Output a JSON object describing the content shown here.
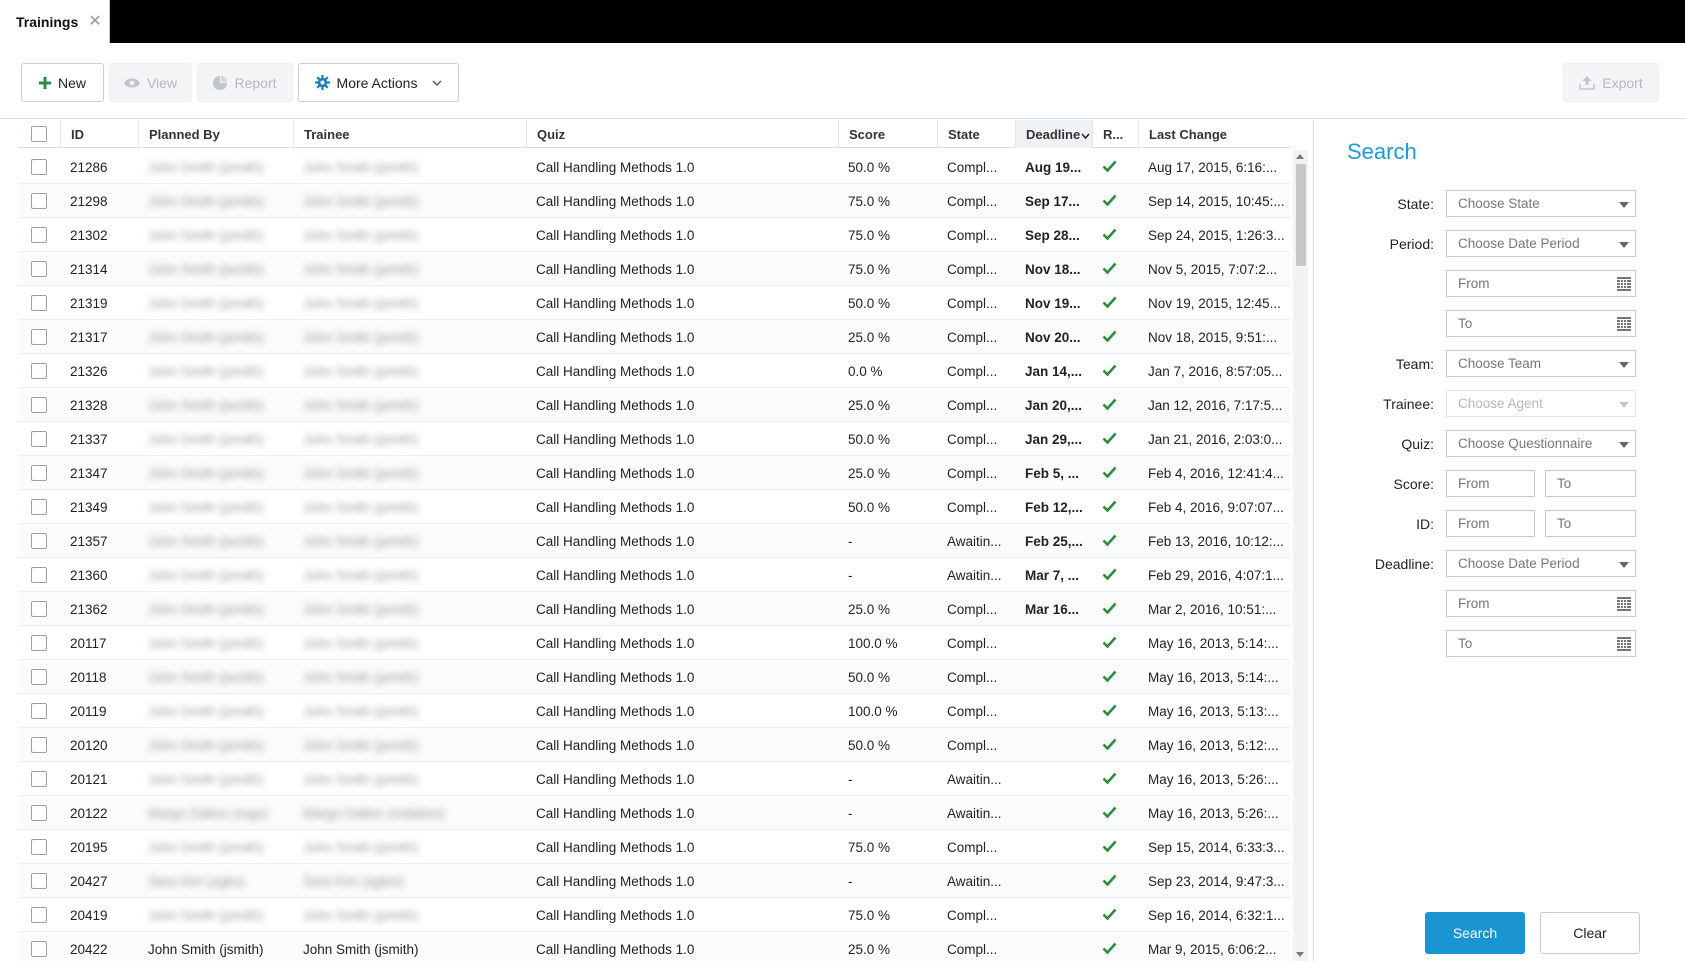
{
  "tab": {
    "label": "Trainings",
    "close": "✕"
  },
  "toolbar": {
    "new_label": "New",
    "view_label": "View",
    "report_label": "Report",
    "more_label": "More Actions",
    "export_label": "Export"
  },
  "colors": {
    "accent": "#1a95d1",
    "check": "#2e8b3d",
    "new_plus": "#2e8b3d"
  },
  "columns": {
    "id": "ID",
    "planned_by": "Planned By",
    "trainee": "Trainee",
    "quiz": "Quiz",
    "score": "Score",
    "state": "State",
    "deadline": "Deadline",
    "r": "R...",
    "last_change": "Last Change"
  },
  "rows": [
    {
      "id": "21286",
      "planned_by": "John Smith (jsmith)",
      "trainee": "John Smith (jsmith)",
      "quiz": "Call Handling Methods 1.0",
      "score": "50.0 %",
      "state": "Compl...",
      "deadline": "Aug 19...",
      "last_change": "Aug 17, 2015, 6:16:..."
    },
    {
      "id": "21298",
      "planned_by": "John Smith (jsmith)",
      "trainee": "John Smith (jsmith)",
      "quiz": "Call Handling Methods 1.0",
      "score": "75.0 %",
      "state": "Compl...",
      "deadline": "Sep 17...",
      "last_change": "Sep 14, 2015, 10:45:..."
    },
    {
      "id": "21302",
      "planned_by": "John Smith (jsmith)",
      "trainee": "John Smith (jsmith)",
      "quiz": "Call Handling Methods 1.0",
      "score": "75.0 %",
      "state": "Compl...",
      "deadline": "Sep 28...",
      "last_change": "Sep 24, 2015, 1:26:3..."
    },
    {
      "id": "21314",
      "planned_by": "John Smith (jsmith)",
      "trainee": "John Smith (jsmith)",
      "quiz": "Call Handling Methods 1.0",
      "score": "75.0 %",
      "state": "Compl...",
      "deadline": "Nov 18...",
      "last_change": "Nov 5, 2015, 7:07:2..."
    },
    {
      "id": "21319",
      "planned_by": "John Smith (jsmith)",
      "trainee": "John Smith (jsmith)",
      "quiz": "Call Handling Methods 1.0",
      "score": "50.0 %",
      "state": "Compl...",
      "deadline": "Nov 19...",
      "last_change": "Nov 19, 2015, 12:45..."
    },
    {
      "id": "21317",
      "planned_by": "John Smith (jsmith)",
      "trainee": "John Smith (jsmith)",
      "quiz": "Call Handling Methods 1.0",
      "score": "25.0 %",
      "state": "Compl...",
      "deadline": "Nov 20...",
      "last_change": "Nov 18, 2015, 9:51:..."
    },
    {
      "id": "21326",
      "planned_by": "John Smith (jsmith)",
      "trainee": "John Smith (jsmith)",
      "quiz": "Call Handling Methods 1.0",
      "score": "0.0 %",
      "state": "Compl...",
      "deadline": "Jan 14,...",
      "last_change": "Jan 7, 2016, 8:57:05..."
    },
    {
      "id": "21328",
      "planned_by": "John Smith (jsmith)",
      "trainee": "John Smith (jsmith)",
      "quiz": "Call Handling Methods 1.0",
      "score": "25.0 %",
      "state": "Compl...",
      "deadline": "Jan 20,...",
      "last_change": "Jan 12, 2016, 7:17:5..."
    },
    {
      "id": "21337",
      "planned_by": "John Smith (jsmith)",
      "trainee": "John Smith (jsmith)",
      "quiz": "Call Handling Methods 1.0",
      "score": "50.0 %",
      "state": "Compl...",
      "deadline": "Jan 29,...",
      "last_change": "Jan 21, 2016, 2:03:0..."
    },
    {
      "id": "21347",
      "planned_by": "John Smith (jsmith)",
      "trainee": "John Smith (jsmith)",
      "quiz": "Call Handling Methods 1.0",
      "score": "25.0 %",
      "state": "Compl...",
      "deadline": "Feb 5, ...",
      "last_change": "Feb 4, 2016, 12:41:4..."
    },
    {
      "id": "21349",
      "planned_by": "John Smith (jsmith)",
      "trainee": "John Smith (jsmith)",
      "quiz": "Call Handling Methods 1.0",
      "score": "50.0 %",
      "state": "Compl...",
      "deadline": "Feb 12,...",
      "last_change": "Feb 4, 2016, 9:07:07..."
    },
    {
      "id": "21357",
      "planned_by": "John Smith (jsmith)",
      "trainee": "John Smith (jsmith)",
      "quiz": "Call Handling Methods 1.0",
      "score": "-",
      "state": "Awaitin...",
      "deadline": "Feb 25,...",
      "last_change": "Feb 13, 2016, 10:12:..."
    },
    {
      "id": "21360",
      "planned_by": "John Smith (jsmith)",
      "trainee": "John Smith (jsmith)",
      "quiz": "Call Handling Methods 1.0",
      "score": "-",
      "state": "Awaitin...",
      "deadline": "Mar 7, ...",
      "last_change": "Feb 29, 2016, 4:07:1..."
    },
    {
      "id": "21362",
      "planned_by": "John Smith (jsmith)",
      "trainee": "John Smith (jsmith)",
      "quiz": "Call Handling Methods 1.0",
      "score": "25.0 %",
      "state": "Compl...",
      "deadline": "Mar 16...",
      "last_change": "Mar 2, 2016, 10:51:..."
    },
    {
      "id": "20117",
      "planned_by": "John Smith (jsmith)",
      "trainee": "John Smith (jsmith)",
      "quiz": "Call Handling Methods 1.0",
      "score": "100.0 %",
      "state": "Compl...",
      "deadline": "",
      "last_change": "May 16, 2013, 5:14:..."
    },
    {
      "id": "20118",
      "planned_by": "John Smith (jsmith)",
      "trainee": "John Smith (jsmith)",
      "quiz": "Call Handling Methods 1.0",
      "score": "50.0 %",
      "state": "Compl...",
      "deadline": "",
      "last_change": "May 16, 2013, 5:14:..."
    },
    {
      "id": "20119",
      "planned_by": "John Smith (jsmith)",
      "trainee": "John Smith (jsmith)",
      "quiz": "Call Handling Methods 1.0",
      "score": "100.0 %",
      "state": "Compl...",
      "deadline": "",
      "last_change": "May 16, 2013, 5:13:..."
    },
    {
      "id": "20120",
      "planned_by": "John Smith (jsmith)",
      "trainee": "John Smith (jsmith)",
      "quiz": "Call Handling Methods 1.0",
      "score": "50.0 %",
      "state": "Compl...",
      "deadline": "",
      "last_change": "May 16, 2013, 5:12:..."
    },
    {
      "id": "20121",
      "planned_by": "John Smith (jsmith)",
      "trainee": "John Smith (jsmith)",
      "quiz": "Call Handling Methods 1.0",
      "score": "-",
      "state": "Awaitin...",
      "deadline": "",
      "last_change": "May 16, 2013, 5:26:..."
    },
    {
      "id": "20122",
      "planned_by": "Margo Dalton (mgo)",
      "trainee": "Margo Dalton (mdalton)",
      "quiz": "Call Handling Methods 1.0",
      "score": "-",
      "state": "Awaitin...",
      "deadline": "",
      "last_change": "May 16, 2013, 5:26:..."
    },
    {
      "id": "20195",
      "planned_by": "John Smith (jsmith)",
      "trainee": "John Smith (jsmith)",
      "quiz": "Call Handling Methods 1.0",
      "score": "75.0 %",
      "state": "Compl...",
      "deadline": "",
      "last_change": "Sep 15, 2014, 6:33:3..."
    },
    {
      "id": "20427",
      "planned_by": "Sara Kim (sgkn)",
      "trainee": "Sara Kim (sgkm)",
      "quiz": "Call Handling Methods 1.0",
      "score": "-",
      "state": "Awaitin...",
      "deadline": "",
      "last_change": "Sep 23, 2014, 9:47:3..."
    },
    {
      "id": "20419",
      "planned_by": "John Smith (jsmith)",
      "trainee": "John Smith (jsmith)",
      "quiz": "Call Handling Methods 1.0",
      "score": "75.0 %",
      "state": "Compl...",
      "deadline": "",
      "last_change": "Sep 16, 2014, 6:32:1..."
    },
    {
      "id": "20422",
      "planned_by": "John Smith (jsmith)",
      "trainee": "John Smith (jsmith)",
      "quiz": "Call Handling Methods 1.0",
      "score": "25.0 %",
      "state": "Compl...",
      "deadline": "",
      "last_change": "Mar 9, 2015, 6:06:2..."
    }
  ],
  "blurred_rows": 23,
  "search": {
    "title": "Search",
    "state_label": "State:",
    "state_placeholder": "Choose State",
    "period_label": "Period:",
    "period_placeholder": "Choose Date Period",
    "period_from": "From",
    "period_to": "To",
    "team_label": "Team:",
    "team_placeholder": "Choose Team",
    "trainee_label": "Trainee:",
    "trainee_placeholder": "Choose Agent",
    "quiz_label": "Quiz:",
    "quiz_placeholder": "Choose Questionnaire",
    "score_label": "Score:",
    "score_from": "From",
    "score_to": "To",
    "id_label": "ID:",
    "id_from": "From",
    "id_to": "To",
    "deadline_label": "Deadline:",
    "deadline_placeholder": "Choose Date Period",
    "deadline_from": "From",
    "deadline_to": "To",
    "search_button": "Search",
    "clear_button": "Clear"
  }
}
